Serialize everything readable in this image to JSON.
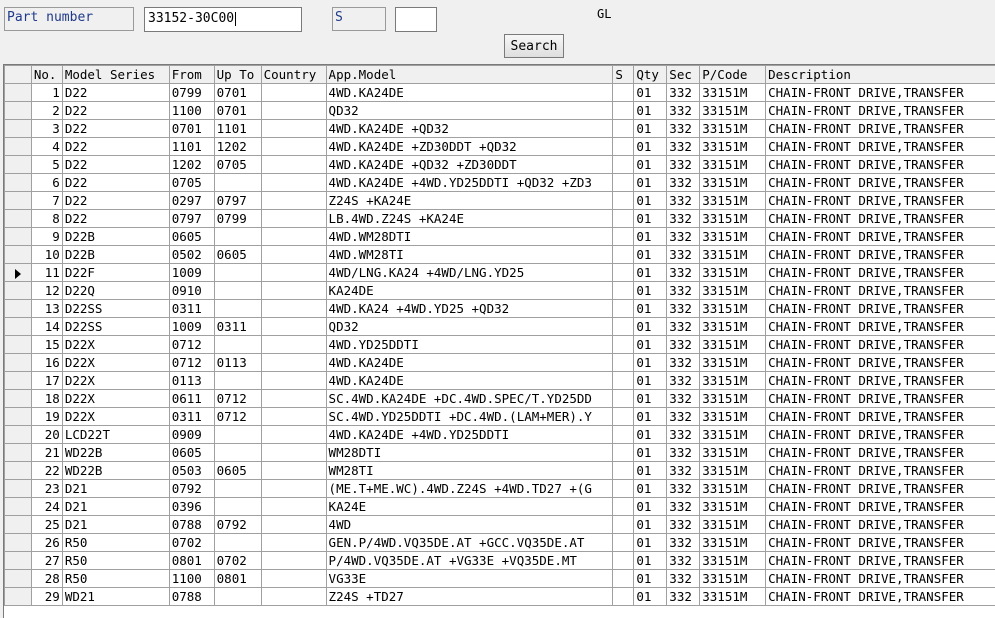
{
  "header": {
    "part_number_label": "Part number",
    "part_number_value": "33152-30C00",
    "s_label": "S",
    "s_value": "",
    "gl_label": "GL",
    "search_button": "Search"
  },
  "table": {
    "columns": [
      "No.",
      "Model Series",
      "From",
      "Up To",
      "Country",
      "App.Model",
      "S",
      "Qty",
      "Sec",
      "P/Code",
      "Description"
    ],
    "current_row": 11,
    "rows": [
      [
        "1",
        "D22",
        "0799",
        "0701",
        "",
        "4WD.KA24DE",
        "",
        "01",
        "332",
        "33151M",
        "CHAIN-FRONT DRIVE,TRANSFER"
      ],
      [
        "2",
        "D22",
        "1100",
        "0701",
        "",
        "QD32",
        "",
        "01",
        "332",
        "33151M",
        "CHAIN-FRONT DRIVE,TRANSFER"
      ],
      [
        "3",
        "D22",
        "0701",
        "1101",
        "",
        "4WD.KA24DE +QD32",
        "",
        "01",
        "332",
        "33151M",
        "CHAIN-FRONT DRIVE,TRANSFER"
      ],
      [
        "4",
        "D22",
        "1101",
        "1202",
        "",
        "4WD.KA24DE +ZD30DDT +QD32",
        "",
        "01",
        "332",
        "33151M",
        "CHAIN-FRONT DRIVE,TRANSFER"
      ],
      [
        "5",
        "D22",
        "1202",
        "0705",
        "",
        "4WD.KA24DE +QD32 +ZD30DDT",
        "",
        "01",
        "332",
        "33151M",
        "CHAIN-FRONT DRIVE,TRANSFER"
      ],
      [
        "6",
        "D22",
        "0705",
        "",
        "",
        "4WD.KA24DE +4WD.YD25DDTI +QD32 +ZD3",
        "",
        "01",
        "332",
        "33151M",
        "CHAIN-FRONT DRIVE,TRANSFER"
      ],
      [
        "7",
        "D22",
        "0297",
        "0797",
        "",
        "Z24S +KA24E",
        "",
        "01",
        "332",
        "33151M",
        "CHAIN-FRONT DRIVE,TRANSFER"
      ],
      [
        "8",
        "D22",
        "0797",
        "0799",
        "",
        "LB.4WD.Z24S +KA24E",
        "",
        "01",
        "332",
        "33151M",
        "CHAIN-FRONT DRIVE,TRANSFER"
      ],
      [
        "9",
        "D22B",
        "0605",
        "",
        "",
        "4WD.WM28DTI",
        "",
        "01",
        "332",
        "33151M",
        "CHAIN-FRONT DRIVE,TRANSFER"
      ],
      [
        "10",
        "D22B",
        "0502",
        "0605",
        "",
        "4WD.WM28TI",
        "",
        "01",
        "332",
        "33151M",
        "CHAIN-FRONT DRIVE,TRANSFER"
      ],
      [
        "11",
        "D22F",
        "1009",
        "",
        "",
        "4WD/LNG.KA24 +4WD/LNG.YD25",
        "",
        "01",
        "332",
        "33151M",
        "CHAIN-FRONT DRIVE,TRANSFER"
      ],
      [
        "12",
        "D22Q",
        "0910",
        "",
        "",
        "KA24DE",
        "",
        "01",
        "332",
        "33151M",
        "CHAIN-FRONT DRIVE,TRANSFER"
      ],
      [
        "13",
        "D22SS",
        "0311",
        "",
        "",
        "4WD.KA24 +4WD.YD25 +QD32",
        "",
        "01",
        "332",
        "33151M",
        "CHAIN-FRONT DRIVE,TRANSFER"
      ],
      [
        "14",
        "D22SS",
        "1009",
        "0311",
        "",
        "QD32",
        "",
        "01",
        "332",
        "33151M",
        "CHAIN-FRONT DRIVE,TRANSFER"
      ],
      [
        "15",
        "D22X",
        "0712",
        "",
        "",
        "4WD.YD25DDTI",
        "",
        "01",
        "332",
        "33151M",
        "CHAIN-FRONT DRIVE,TRANSFER"
      ],
      [
        "16",
        "D22X",
        "0712",
        "0113",
        "",
        "4WD.KA24DE",
        "",
        "01",
        "332",
        "33151M",
        "CHAIN-FRONT DRIVE,TRANSFER"
      ],
      [
        "17",
        "D22X",
        "0113",
        "",
        "",
        "4WD.KA24DE",
        "",
        "01",
        "332",
        "33151M",
        "CHAIN-FRONT DRIVE,TRANSFER"
      ],
      [
        "18",
        "D22X",
        "0611",
        "0712",
        "",
        "SC.4WD.KA24DE +DC.4WD.SPEC/T.YD25DD",
        "",
        "01",
        "332",
        "33151M",
        "CHAIN-FRONT DRIVE,TRANSFER"
      ],
      [
        "19",
        "D22X",
        "0311",
        "0712",
        "",
        "SC.4WD.YD25DDTI +DC.4WD.(LAM+MER).Y",
        "",
        "01",
        "332",
        "33151M",
        "CHAIN-FRONT DRIVE,TRANSFER"
      ],
      [
        "20",
        "LCD22T",
        "0909",
        "",
        "",
        "4WD.KA24DE +4WD.YD25DDTI",
        "",
        "01",
        "332",
        "33151M",
        "CHAIN-FRONT DRIVE,TRANSFER"
      ],
      [
        "21",
        "WD22B",
        "0605",
        "",
        "",
        "WM28DTI",
        "",
        "01",
        "332",
        "33151M",
        "CHAIN-FRONT DRIVE,TRANSFER"
      ],
      [
        "22",
        "WD22B",
        "0503",
        "0605",
        "",
        "WM28TI",
        "",
        "01",
        "332",
        "33151M",
        "CHAIN-FRONT DRIVE,TRANSFER"
      ],
      [
        "23",
        "D21",
        "0792",
        "",
        "",
        "(ME.T+ME.WC).4WD.Z24S +4WD.TD27 +(G",
        "",
        "01",
        "332",
        "33151M",
        "CHAIN-FRONT DRIVE,TRANSFER"
      ],
      [
        "24",
        "D21",
        "0396",
        "",
        "",
        "KA24E",
        "",
        "01",
        "332",
        "33151M",
        "CHAIN-FRONT DRIVE,TRANSFER"
      ],
      [
        "25",
        "D21",
        "0788",
        "0792",
        "",
        "4WD",
        "",
        "01",
        "332",
        "33151M",
        "CHAIN-FRONT DRIVE,TRANSFER"
      ],
      [
        "26",
        "R50",
        "0702",
        "",
        "",
        "GEN.P/4WD.VQ35DE.AT +GCC.VQ35DE.AT",
        "",
        "01",
        "332",
        "33151M",
        "CHAIN-FRONT DRIVE,TRANSFER"
      ],
      [
        "27",
        "R50",
        "0801",
        "0702",
        "",
        "P/4WD.VQ35DE.AT +VG33E +VQ35DE.MT",
        "",
        "01",
        "332",
        "33151M",
        "CHAIN-FRONT DRIVE,TRANSFER"
      ],
      [
        "28",
        "R50",
        "1100",
        "0801",
        "",
        "VG33E",
        "",
        "01",
        "332",
        "33151M",
        "CHAIN-FRONT DRIVE,TRANSFER"
      ],
      [
        "29",
        "WD21",
        "0788",
        "",
        "",
        "Z24S +TD27",
        "",
        "01",
        "332",
        "33151M",
        "CHAIN-FRONT DRIVE,TRANSFER"
      ]
    ]
  }
}
